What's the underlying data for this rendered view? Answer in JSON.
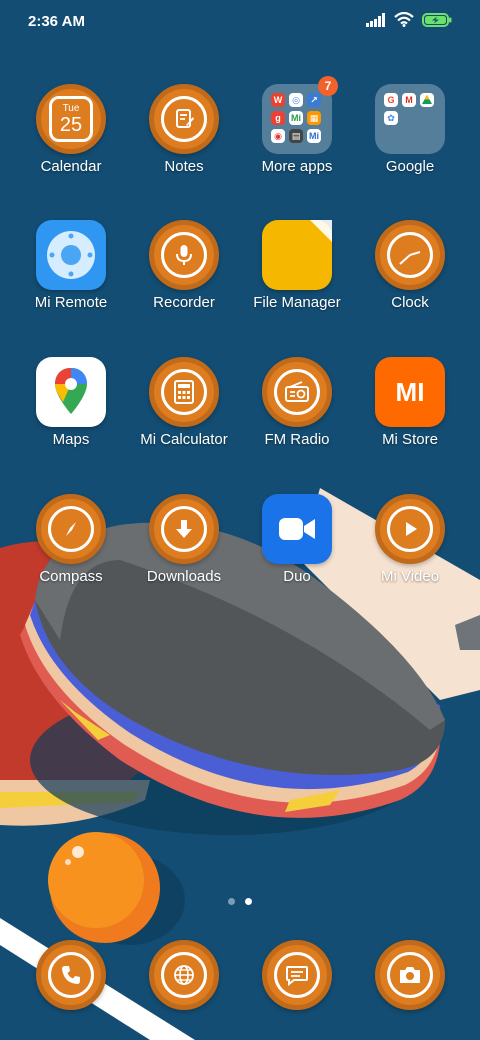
{
  "status_bar": {
    "time": "2:36 AM",
    "icons": [
      "signal-icon",
      "wifi-icon",
      "battery-charging-icon"
    ]
  },
  "colors": {
    "background": "#134d73",
    "icon_orange": "#de7c20",
    "badge": "#f3622b"
  },
  "home_apps": [
    {
      "name": "Calendar",
      "icon": "calendar-icon",
      "day": "Tue",
      "date": "25"
    },
    {
      "name": "Notes",
      "icon": "notes-icon"
    },
    {
      "name": "More apps",
      "icon": "folder-icon",
      "badge": "7"
    },
    {
      "name": "Google",
      "icon": "folder-icon"
    },
    {
      "name": "Mi Remote",
      "icon": "remote-icon"
    },
    {
      "name": "Recorder",
      "icon": "microphone-icon"
    },
    {
      "name": "File Manager",
      "icon": "file-manager-icon"
    },
    {
      "name": "Clock",
      "icon": "clock-icon"
    },
    {
      "name": "Maps",
      "icon": "maps-icon"
    },
    {
      "name": "Mi Calculator",
      "icon": "calculator-icon"
    },
    {
      "name": "FM Radio",
      "icon": "radio-icon"
    },
    {
      "name": "Mi Store",
      "icon": "mi-store-icon",
      "logo_text": "MI"
    },
    {
      "name": "Compass",
      "icon": "compass-icon"
    },
    {
      "name": "Downloads",
      "icon": "download-icon"
    },
    {
      "name": "Duo",
      "icon": "video-camera-icon"
    },
    {
      "name": "Mi Video",
      "icon": "play-icon"
    }
  ],
  "page_indicator": {
    "pages": 2,
    "current": 2
  },
  "dock": [
    {
      "icon": "phone-icon"
    },
    {
      "icon": "browser-icon"
    },
    {
      "icon": "messages-icon"
    },
    {
      "icon": "camera-icon"
    }
  ]
}
